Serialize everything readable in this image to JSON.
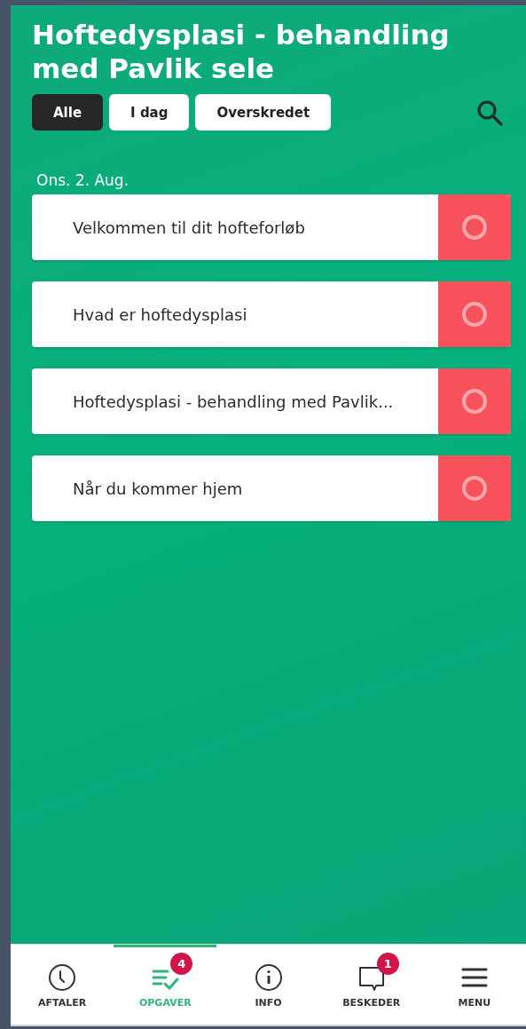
{
  "header": {
    "title": "Hoftedysplasi - behandling med Pavlik sele"
  },
  "filters": [
    {
      "label": "Alle",
      "selected": true
    },
    {
      "label": "I dag",
      "selected": false
    },
    {
      "label": "Overskredet",
      "selected": false
    }
  ],
  "date": "Ons. 2. Aug.",
  "tasks": [
    {
      "title": "Velkommen til dit hofteforløb",
      "done": false
    },
    {
      "title": "Hvad er hoftedysplasi",
      "done": false
    },
    {
      "title": "Hoftedysplasi - behandling med Pavlik...",
      "done": false
    },
    {
      "title": "Når du kommer hjem",
      "done": false
    }
  ],
  "nav": [
    {
      "kind": "clock",
      "label": "AFTALER",
      "selected": false
    },
    {
      "kind": "tasks",
      "label": "OPGAVER",
      "selected": true,
      "badge": "4"
    },
    {
      "kind": "info",
      "label": "INFO",
      "selected": false
    },
    {
      "kind": "chat",
      "label": "BESKEDER",
      "selected": false,
      "badge": "1"
    },
    {
      "kind": "menu",
      "label": "MENU",
      "selected": false
    }
  ]
}
